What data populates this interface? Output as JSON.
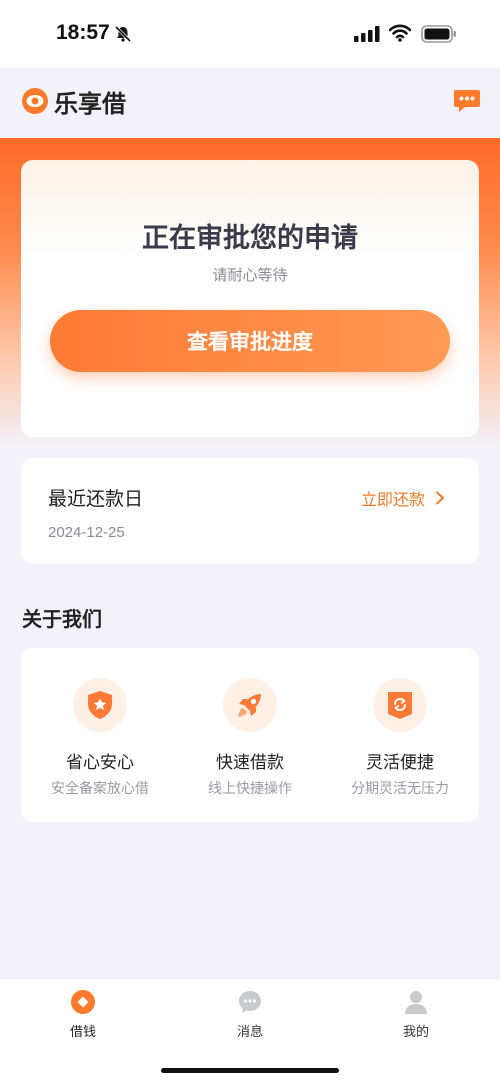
{
  "status_bar": {
    "time": "18:57"
  },
  "header": {
    "app_name": "乐享借",
    "logo_icon": "eye-logo-icon",
    "message_icon": "chat-bubble-icon"
  },
  "approval": {
    "title": "正在审批您的申请",
    "subtitle": "请耐心等待",
    "button_label": "查看审批进度"
  },
  "repayment": {
    "title": "最近还款日",
    "date": "2024-12-25",
    "action_label": "立即还款"
  },
  "about": {
    "heading": "关于我们",
    "features": [
      {
        "title": "省心安心",
        "desc": "安全备案放心借",
        "icon": "shield-star-icon"
      },
      {
        "title": "快速借款",
        "desc": "线上快捷操作",
        "icon": "rocket-icon"
      },
      {
        "title": "灵活便捷",
        "desc": "分期灵活无压力",
        "icon": "refresh-tag-icon"
      }
    ]
  },
  "tabs": [
    {
      "label": "借钱",
      "active": true,
      "icon": "loan-icon"
    },
    {
      "label": "消息",
      "active": false,
      "icon": "message-icon"
    },
    {
      "label": "我的",
      "active": false,
      "icon": "profile-icon"
    }
  ],
  "colors": {
    "accent": "#ff7a35",
    "link": "#f07a2a",
    "background": "#f3f2fb"
  }
}
